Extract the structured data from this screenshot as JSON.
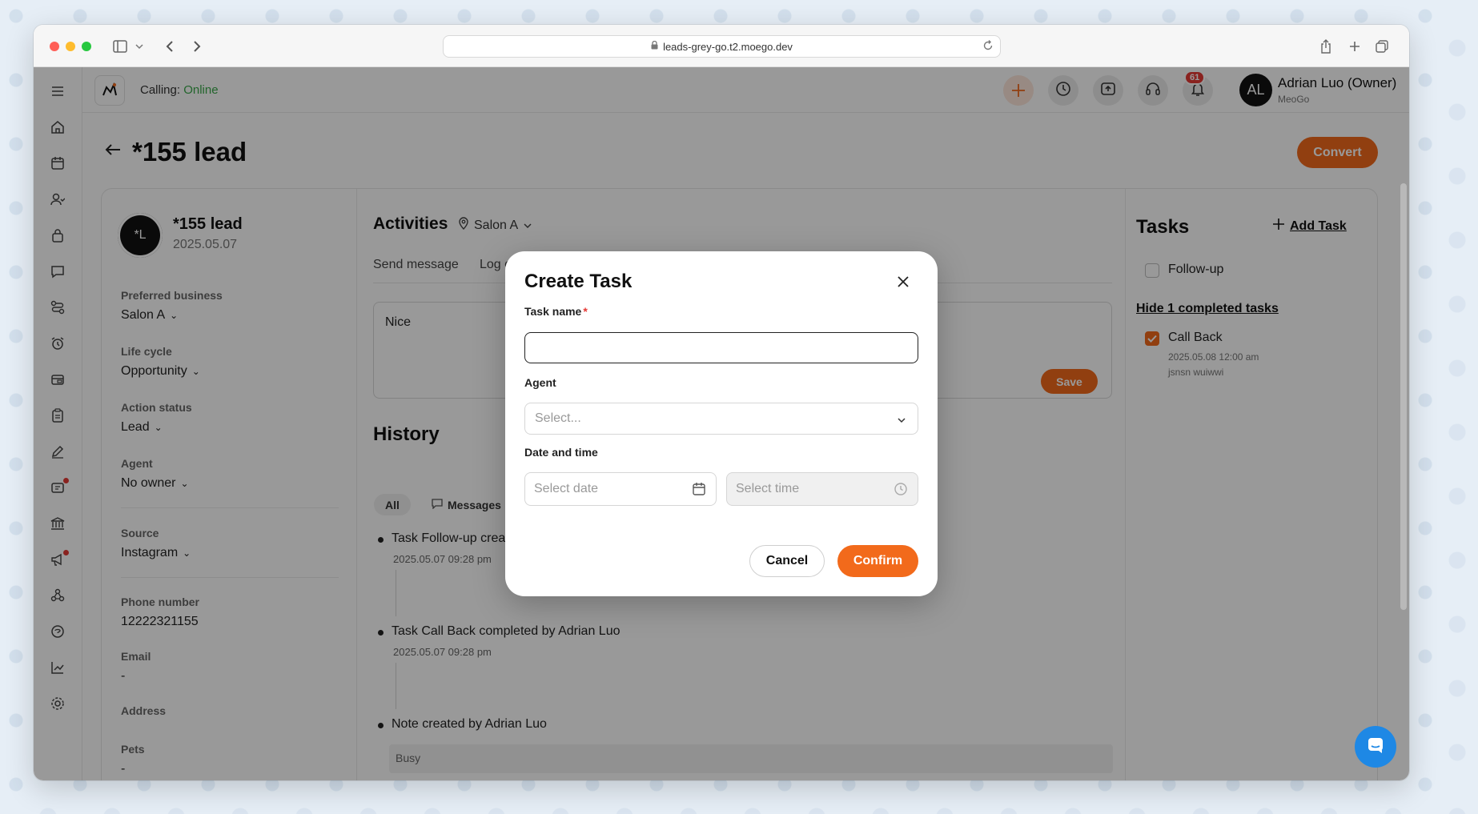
{
  "browser": {
    "url": "leads-grey-go.t2.moego.dev"
  },
  "topbar": {
    "calling_label": "Calling:",
    "calling_status": "Online",
    "notification_count": "61",
    "avatar_initials": "AL",
    "user_name": "Adrian Luo (Owner)",
    "user_org": "MeoGo"
  },
  "page": {
    "title": "*155 lead",
    "convert_label": "Convert"
  },
  "lead": {
    "avatar_initials": "*L",
    "name": "*155 lead",
    "created_date": "2025.05.07",
    "fields": {
      "preferred_business_label": "Preferred business",
      "preferred_business_value": "Salon A",
      "life_cycle_label": "Life cycle",
      "life_cycle_value": "Opportunity",
      "action_status_label": "Action status",
      "action_status_value": "Lead",
      "agent_label": "Agent",
      "agent_value": "No owner",
      "source_label": "Source",
      "source_value": "Instagram",
      "phone_label": "Phone number",
      "phone_value": "12222321155",
      "email_label": "Email",
      "email_value": "-",
      "address_label": "Address",
      "pets_label": "Pets",
      "pets_value": "-"
    }
  },
  "activities": {
    "title": "Activities",
    "location": "Salon A",
    "tabs": [
      "Send message",
      "Log c"
    ],
    "note_text": "Nice",
    "save_label": "Save"
  },
  "history": {
    "title": "History",
    "filters": [
      "All",
      "Messages"
    ],
    "items": [
      {
        "text": "Task Follow-up creat",
        "time": "2025.05.07 09:28 pm"
      },
      {
        "text": "Task Call Back completed by Adrian Luo",
        "time": "2025.05.07 09:28 pm"
      },
      {
        "text": "Note created by Adrian Luo",
        "time": ""
      }
    ],
    "note_preview": "Busy"
  },
  "tasks": {
    "title": "Tasks",
    "add_label": "Add Task",
    "open": [
      {
        "label": "Follow-up",
        "checked": false
      }
    ],
    "hide_completed_label": "Hide 1 completed tasks",
    "completed": [
      {
        "label": "Call Back",
        "checked": true,
        "datetime": "2025.05.08 12:00 am",
        "assignee": "jsnsn wuiwwi"
      }
    ]
  },
  "modal": {
    "title": "Create Task",
    "task_name_label": "Task name",
    "required_mark": "*",
    "task_name_value": "",
    "agent_label": "Agent",
    "agent_placeholder": "Select...",
    "datetime_label": "Date and time",
    "date_placeholder": "Select date",
    "time_placeholder": "Select time",
    "cancel_label": "Cancel",
    "confirm_label": "Confirm"
  },
  "colors": {
    "accent": "#f26a1b",
    "online": "#3aa84a",
    "badge": "#e53935",
    "chat": "#1e88e5"
  },
  "icons": {
    "sidebar": [
      "menu-icon",
      "home-icon",
      "calendar-icon",
      "clients-icon",
      "lock-icon",
      "message-icon",
      "routes-icon",
      "alarm-icon",
      "wallet-icon",
      "clipboard-icon",
      "pen-icon",
      "ticket-icon",
      "bank-icon",
      "megaphone-icon",
      "network-icon",
      "support-icon",
      "chart-icon",
      "settings-icon"
    ],
    "topbar": [
      "plus-icon",
      "clock-icon",
      "upload-icon",
      "headset-icon",
      "bell-icon"
    ]
  }
}
